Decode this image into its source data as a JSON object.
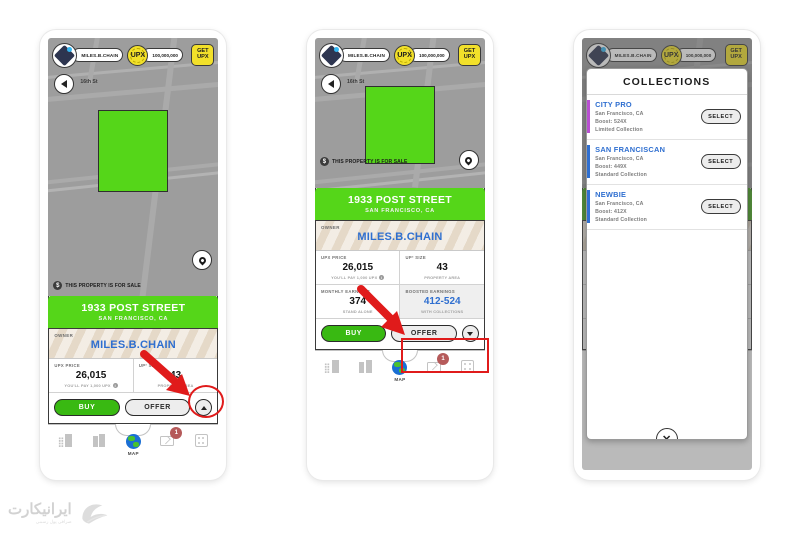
{
  "header": {
    "username": "MILES.B.CHAIN",
    "coin_label": "UPX",
    "balance": "100,000,000",
    "get_upx_line1": "GET",
    "get_upx_line2": "UPX"
  },
  "map": {
    "street_label": "16th St",
    "for_sale_text": "THIS PROPERTY IS FOR SALE",
    "for_sale_icon": "dollar-icon",
    "back_icon": "back-arrow-icon",
    "pin_icon": "location-pin-icon"
  },
  "property": {
    "address": "1933 POST STREET",
    "city": "SAN FRANCISCO, CA",
    "owner_label": "OWNER",
    "owner_name": "MILES.B.CHAIN",
    "upx_price_label": "UPX PRICE",
    "upx_price_value": "26,015",
    "upx_price_sub": "YOU'LL PAY 1,000 UPX",
    "upx_size_label": "UP² SIZE",
    "upx_size_value": "43",
    "upx_size_sub": "PROPERTY AREA",
    "monthly_label": "MONTHLY EARNINGS",
    "monthly_value": "374",
    "monthly_sub": "STAND ALONE",
    "boosted_label": "BOOSTED EARNINGS",
    "boosted_value": "412-524",
    "boosted_sub": "WITH COLLECTIONS"
  },
  "actions": {
    "buy_label": "BUY",
    "offer_label": "OFFER",
    "expand_icon": "chevron-up-icon",
    "collapse_icon": "chevron-down-icon"
  },
  "nav": {
    "items": [
      {
        "label": "",
        "icon": "buildings-icon"
      },
      {
        "label": "",
        "icon": "property-icon"
      },
      {
        "label": "MAP",
        "icon": "globe-icon"
      },
      {
        "label": "",
        "icon": "mail-icon"
      },
      {
        "label": "",
        "icon": "grid-icon"
      }
    ],
    "mail_badge": "1"
  },
  "modal": {
    "title": "COLLECTIONS",
    "close_icon": "close-icon",
    "select_label": "SELECT",
    "collections": [
      {
        "name": "CITY PRO",
        "location": "San Francisco, CA",
        "boost": "Boost: 524X",
        "tier": "Limited Collection",
        "bar_color": "#b84fd1"
      },
      {
        "name": "SAN FRANCISCAN",
        "location": "San Francisco, CA",
        "boost": "Boost: 449X",
        "tier": "Standard Collection",
        "bar_color": "#2f6fd0"
      },
      {
        "name": "NEWBIE",
        "location": "San Francisco, CA",
        "boost": "Boost: 412X",
        "tier": "Standard Collection",
        "bar_color": "#2f6fd0"
      }
    ]
  },
  "annotations": {
    "highlight_color": "#e01b1b"
  },
  "watermark": {
    "main": "ایرانیکارت",
    "sub": "صرافی پول رسمی"
  },
  "colors": {
    "green": "#55d619",
    "yellow": "#f2e02a",
    "blue": "#2f6fd0",
    "map_gray": "#9d9d9d"
  }
}
